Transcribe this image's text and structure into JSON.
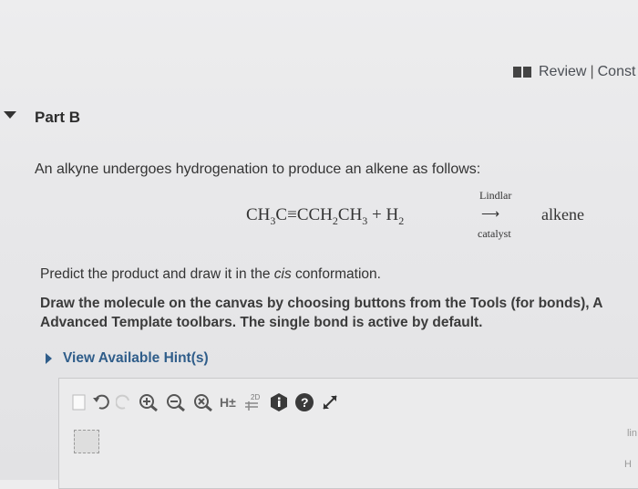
{
  "header": {
    "review_label": "Review",
    "separator": "|",
    "constants_label": "Const"
  },
  "part": {
    "title": "Part B"
  },
  "question": {
    "intro": "An alkyne undergoes hydrogenation to produce an alkene as follows:",
    "reaction": {
      "reactant_parts": [
        "CH",
        "3",
        "C",
        "≡",
        "CCH",
        "2",
        "CH",
        "3",
        " + H",
        "2"
      ],
      "catalyst_top": "Lindlar",
      "arrow": "⟶",
      "catalyst_bottom": "catalyst",
      "product": "alkene"
    },
    "predict_prefix": "Predict the product and draw it in the ",
    "predict_italic": "cis",
    "predict_suffix": " conformation.",
    "instructions_line1": "Draw the molecule on the canvas by choosing buttons from the Tools (for bonds), A",
    "instructions_line2": "Advanced Template toolbars. The single bond is active by default."
  },
  "hint": {
    "label": "View Available Hint(s)"
  },
  "editor": {
    "tools": [
      "new-icon",
      "undo-icon",
      "redo-icon",
      "zoom-in-icon",
      "zoom-out-icon",
      "zoom-reset-icon",
      "add-hydrogens",
      "2d-clean-icon",
      "info-icon",
      "help-icon",
      "fullscreen-icon"
    ],
    "h_label": "H±",
    "clean_label": "2D",
    "corner_label_1": "lin",
    "corner_label_2": "H"
  }
}
